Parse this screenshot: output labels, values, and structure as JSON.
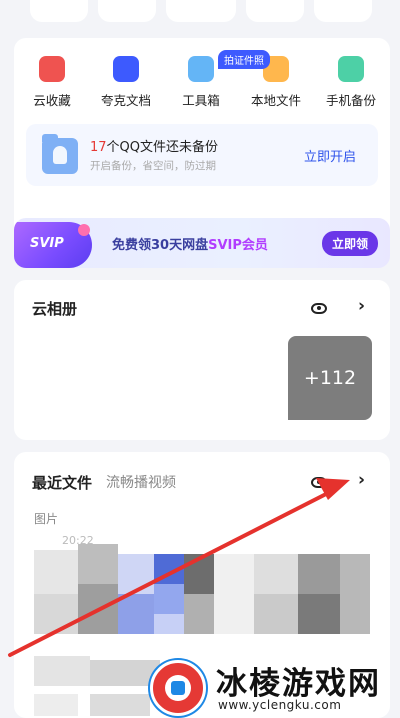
{
  "quick_actions": [
    {
      "label": "云收藏",
      "icon": "cloud-collect-icon",
      "color": "#ef5350"
    },
    {
      "label": "夸克文档",
      "icon": "document-icon",
      "color": "#3d5afe"
    },
    {
      "label": "工具箱",
      "icon": "toolbox-icon",
      "color": "#64b5f6"
    },
    {
      "label": "本地文件",
      "icon": "folder-icon",
      "color": "#ffb74d"
    },
    {
      "label": "手机备份",
      "icon": "phone-backup-icon",
      "color": "#4dd0a6"
    }
  ],
  "toolbox_badge": "拍证件照",
  "backup_banner": {
    "count": "17",
    "title_suffix": "个QQ文件还未备份",
    "subtitle": "开启备份，省空间，防过期",
    "action": "立即开启"
  },
  "promo": {
    "badge": "SVIP",
    "text_prefix": "免费领30天网盘",
    "text_highlight": "SVIP会员",
    "button": "立即领"
  },
  "album": {
    "title": "云相册",
    "more_count": "+112"
  },
  "recent": {
    "title": "最近文件",
    "subtitle": "流畅播视频",
    "category": "图片",
    "timestamp": "20:22"
  },
  "watermark": {
    "name": "冰棱游戏网",
    "url": "www.yclengku.com"
  },
  "colors": {
    "accent": "#2f54eb",
    "annotation_arrow": "#e5322d"
  }
}
